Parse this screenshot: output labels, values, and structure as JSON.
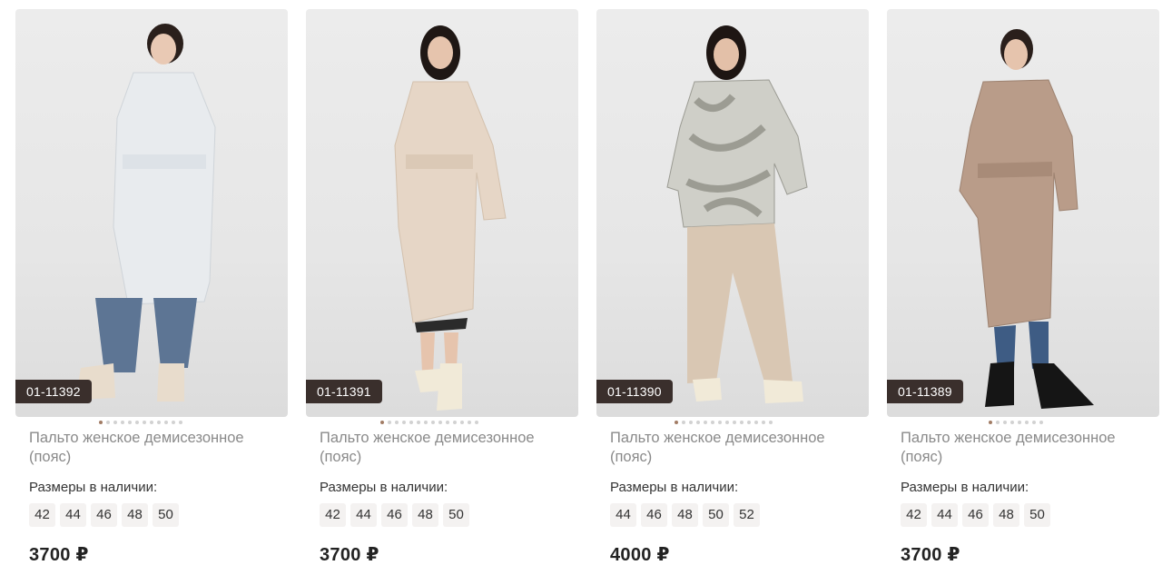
{
  "products": [
    {
      "sku": "01-11392",
      "title": "Пальто женское демисезонное (пояс)",
      "sizes_label": "Размеры в наличии:",
      "sizes": [
        "42",
        "44",
        "46",
        "48",
        "50"
      ],
      "price": "3700 ₽",
      "coat_color": "#e8ebee",
      "dots": 12,
      "active_dot": 1
    },
    {
      "sku": "01-11391",
      "title": "Пальто женское демисезонное (пояс)",
      "sizes_label": "Размеры в наличии:",
      "sizes": [
        "42",
        "44",
        "46",
        "48",
        "50"
      ],
      "price": "3700 ₽",
      "coat_color": "#e6d6c6",
      "dots": 14,
      "active_dot": 1
    },
    {
      "sku": "01-11390",
      "title": "Пальто женское демисезонное (пояс)",
      "sizes_label": "Размеры в наличии:",
      "sizes": [
        "44",
        "46",
        "48",
        "50",
        "52"
      ],
      "price": "4000 ₽",
      "coat_color": "#cfcfc8",
      "dots": 14,
      "active_dot": 1
    },
    {
      "sku": "01-11389",
      "title": "Пальто женское демисезонное (пояс)",
      "sizes_label": "Размеры в наличии:",
      "sizes": [
        "42",
        "44",
        "46",
        "48",
        "50"
      ],
      "price": "3700 ₽",
      "coat_color": "#b99c89",
      "dots": 8,
      "active_dot": 1
    }
  ],
  "colors": {
    "sku_badge_bg": "#3a2f2c",
    "active_dot": "#a27c65",
    "size_chip_bg": "#f4f2f1"
  }
}
